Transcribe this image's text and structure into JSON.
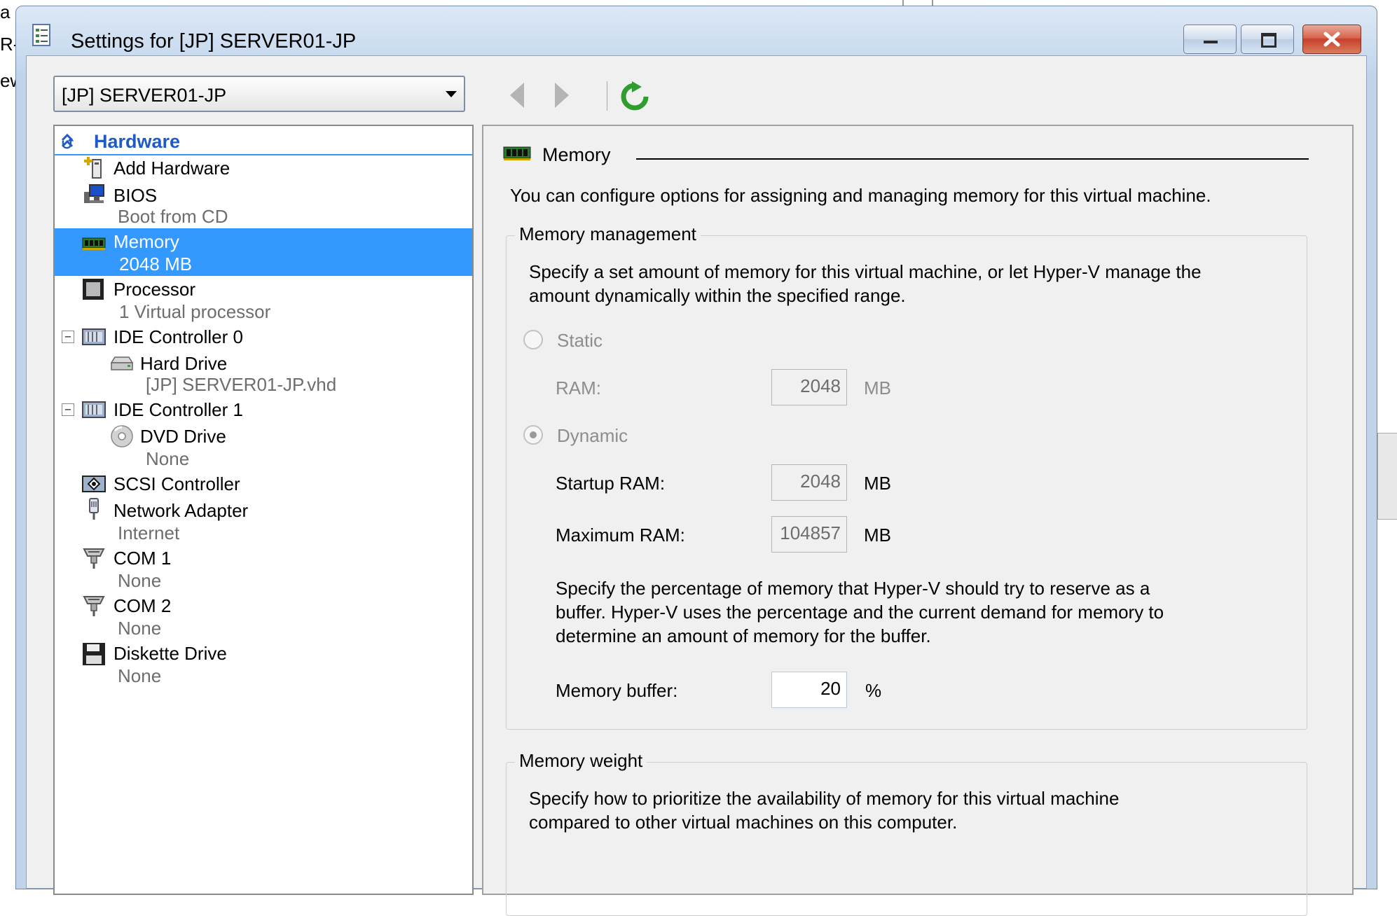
{
  "background": {
    "frag1": "a",
    "frag2": "R-",
    "frag3": "ew"
  },
  "window": {
    "title": "Settings for [JP] SERVER01-JP"
  },
  "toolbar": {
    "vm_selected": "[JP] SERVER01-JP"
  },
  "tree": {
    "header": "Hardware",
    "items": [
      {
        "label": "Add Hardware",
        "sub": ""
      },
      {
        "label": "BIOS",
        "sub": "Boot from CD"
      },
      {
        "label": "Memory",
        "sub": "2048 MB"
      },
      {
        "label": "Processor",
        "sub": "1 Virtual processor"
      },
      {
        "label": "IDE Controller 0",
        "sub": ""
      },
      {
        "label": "Hard Drive",
        "sub": "[JP] SERVER01-JP.vhd"
      },
      {
        "label": "IDE Controller 1",
        "sub": ""
      },
      {
        "label": "DVD Drive",
        "sub": "None"
      },
      {
        "label": "SCSI Controller",
        "sub": ""
      },
      {
        "label": "Network Adapter",
        "sub": "Internet"
      },
      {
        "label": "COM 1",
        "sub": "None"
      },
      {
        "label": "COM 2",
        "sub": "None"
      },
      {
        "label": "Diskette Drive",
        "sub": "None"
      }
    ],
    "expander": "−"
  },
  "memory": {
    "section_title": "Memory",
    "intro": "You can configure options for assigning and managing memory for this virtual machine.",
    "management": {
      "label": "Memory management",
      "desc_line1": "Specify a set amount of memory for this virtual machine, or let Hyper-V manage the",
      "desc_line2": "amount dynamically within the specified range.",
      "static_label": "Static",
      "ram_label": "RAM:",
      "ram_value": "2048",
      "ram_unit": "MB",
      "dynamic_label": "Dynamic",
      "startup_label": "Startup RAM:",
      "startup_value": "2048",
      "startup_unit": "MB",
      "max_label": "Maximum RAM:",
      "max_value": "104857",
      "max_unit": "MB",
      "buffer_desc_line1": "Specify the percentage of memory that Hyper-V should try to reserve as a",
      "buffer_desc_line2": "buffer. Hyper-V uses the percentage and the current demand for memory to",
      "buffer_desc_line3": "determine an amount of memory for the buffer.",
      "buffer_label": "Memory buffer:",
      "buffer_value": "20",
      "buffer_unit": "%"
    },
    "weight": {
      "label": "Memory weight",
      "desc_line1": "Specify how to prioritize the availability of memory for this virtual machine",
      "desc_line2": "compared to other virtual machines on this computer."
    }
  }
}
